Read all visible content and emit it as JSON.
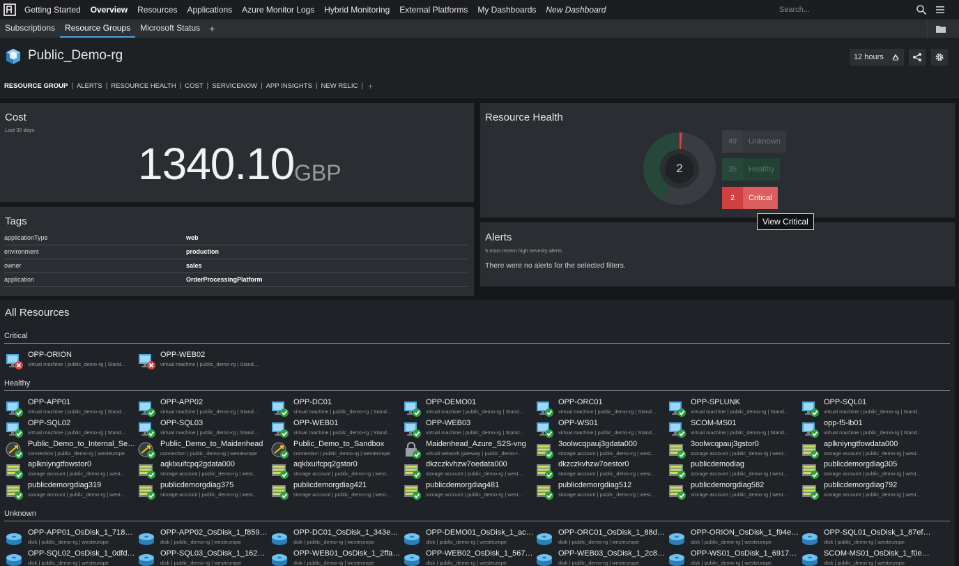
{
  "topnav": {
    "items": [
      {
        "label": "Getting Started"
      },
      {
        "label": "Overview"
      },
      {
        "label": "Resources"
      },
      {
        "label": "Applications"
      },
      {
        "label": "Azure Monitor Logs"
      },
      {
        "label": "Hybrid Monitoring"
      },
      {
        "label": "External Platforms"
      },
      {
        "label": "My Dashboards"
      },
      {
        "label": "New Dashboard"
      }
    ],
    "search_placeholder": "Search..."
  },
  "subnav": {
    "items": [
      {
        "label": "Subscriptions"
      },
      {
        "label": "Resource Groups"
      },
      {
        "label": "Microsoft Status"
      }
    ],
    "add_label": "+"
  },
  "header": {
    "title": "Public_Demo-rg",
    "time_range": "12 hours"
  },
  "tabs": {
    "items": [
      "RESOURCE GROUP",
      "ALERTS",
      "RESOURCE HEALTH",
      "COST",
      "SERVICENOW",
      "APP INSIGHTS",
      "NEW RELIC"
    ],
    "add_label": "+"
  },
  "cost": {
    "title": "Cost",
    "subtitle": "Last 30 days",
    "value": "1340.10",
    "unit": "GBP"
  },
  "tags": {
    "title": "Tags",
    "rows": [
      {
        "key": "applicationType",
        "value": "web"
      },
      {
        "key": "environment",
        "value": "production"
      },
      {
        "key": "owner",
        "value": "sales"
      },
      {
        "key": "application",
        "value": "OrderProcessingPlatform"
      }
    ]
  },
  "health": {
    "title": "Resource Health",
    "center_value": "2",
    "unknown_count": "49",
    "unknown_label": "Unknown",
    "healthy_count": "35",
    "healthy_label": "Healthy",
    "critical_count": "2",
    "critical_label": "Critical",
    "tooltip": "View Critical",
    "colors": {
      "unknown": "#393c40",
      "healthy": "#26473a",
      "critical": "#d64545"
    }
  },
  "alerts": {
    "title": "Alerts",
    "subtitle": "5 most recent high severity alerts",
    "message": "There were no alerts for the selected filters."
  },
  "all_resources": {
    "title": "All Resources",
    "sections": [
      {
        "label": "Critical",
        "items": [
          {
            "name": "OPP-ORION",
            "sub": "virtual machine | public_demo-rg | Stand...",
            "icon": "vm-critical-icon"
          },
          {
            "name": "OPP-WEB02",
            "sub": "virtual machine | public_demo-rg | Stand...",
            "icon": "vm-critical-icon"
          }
        ]
      },
      {
        "label": "Healthy",
        "items": [
          {
            "name": "OPP-APP01",
            "sub": "virtual machine | public_demo-rg | Stand...",
            "icon": "vm-healthy-icon"
          },
          {
            "name": "OPP-APP02",
            "sub": "virtual machine | public_demo-rg | Stand...",
            "icon": "vm-healthy-icon"
          },
          {
            "name": "OPP-DC01",
            "sub": "virtual machine | public_demo-rg | Stand...",
            "icon": "vm-healthy-icon"
          },
          {
            "name": "OPP-DEMO01",
            "sub": "virtual machine | public_demo-rg | Stand...",
            "icon": "vm-healthy-icon"
          },
          {
            "name": "OPP-ORC01",
            "sub": "virtual machine | public_demo-rg | Stand...",
            "icon": "vm-healthy-icon"
          },
          {
            "name": "OPP-SPLUNK",
            "sub": "virtual machine | public_demo-rg | Stand...",
            "icon": "vm-healthy-icon"
          },
          {
            "name": "OPP-SQL01",
            "sub": "virtual machine | public_demo-rg | Stand...",
            "icon": "vm-healthy-icon"
          },
          {
            "name": "OPP-SQL02",
            "sub": "virtual machine | public_demo-rg | Stand...",
            "icon": "vm-healthy-icon"
          },
          {
            "name": "OPP-SQL03",
            "sub": "virtual machine | public_demo-rg | Stand...",
            "icon": "vm-healthy-icon"
          },
          {
            "name": "OPP-WEB01",
            "sub": "virtual machine | public_demo-rg | Stand...",
            "icon": "vm-healthy-icon"
          },
          {
            "name": "OPP-WEB03",
            "sub": "virtual machine | public_demo-rg | Stand...",
            "icon": "vm-healthy-icon"
          },
          {
            "name": "OPP-WS01",
            "sub": "virtual machine | public_demo-rg | Stand...",
            "icon": "vm-healthy-icon"
          },
          {
            "name": "SCOM-MS01",
            "sub": "virtual machine | public_demo-rg | Stand...",
            "icon": "vm-healthy-icon"
          },
          {
            "name": "opp-f5-lb01",
            "sub": "virtual machine | public_demo-rg | Stand...",
            "icon": "vm-healthy-icon"
          },
          {
            "name": "Public_Demo_to_Internal_Servi...",
            "sub": "connection | public_demo-rg | westeurope",
            "icon": "connection-icon"
          },
          {
            "name": "Public_Demo_to_Maidenhead",
            "sub": "connection | public_demo-rg | westeurope",
            "icon": "connection-icon"
          },
          {
            "name": "Public_Demo_to_Sandbox",
            "sub": "connection | public_demo-rg | westeurope",
            "icon": "connection-icon"
          },
          {
            "name": "Maidenhead_Azure_S2S-vng",
            "sub": "virtual network gateway | public_demo-r...",
            "icon": "gateway-icon"
          },
          {
            "name": "3oolwcqpauj3gdata000",
            "sub": "storage account | public_demo-rg | west...",
            "icon": "storage-icon"
          },
          {
            "name": "3oolwcqpauj3gstor0",
            "sub": "storage account | public_demo-rg | west...",
            "icon": "storage-icon"
          },
          {
            "name": "aplkniyngtfowdata000",
            "sub": "storage account | public_demo-rg | west...",
            "icon": "storage-icon"
          },
          {
            "name": "aplkniyngtfowstor0",
            "sub": "storage account | public_demo-rg | west...",
            "icon": "storage-icon"
          },
          {
            "name": "aqklxuifcpq2gdata000",
            "sub": "storage account | public_demo-rg | west...",
            "icon": "storage-icon"
          },
          {
            "name": "aqklxuifcpq2gstor0",
            "sub": "storage account | public_demo-rg | west...",
            "icon": "storage-icon"
          },
          {
            "name": "dkzczkvhzw7oedata000",
            "sub": "storage account | public_demo-rg | west...",
            "icon": "storage-icon"
          },
          {
            "name": "dkzczkvhzw7oestor0",
            "sub": "storage account | public_demo-rg | west...",
            "icon": "storage-icon"
          },
          {
            "name": "publicdemodiag",
            "sub": "storage account | public_demo-rg | west...",
            "icon": "storage-icon"
          },
          {
            "name": "publicdemorgdiag305",
            "sub": "storage account | public_demo-rg | west...",
            "icon": "storage-icon"
          },
          {
            "name": "publicdemorgdiag319",
            "sub": "storage account | public_demo-rg | west...",
            "icon": "storage-icon"
          },
          {
            "name": "publicdemorgdiag375",
            "sub": "storage account | public_demo-rg | west...",
            "icon": "storage-icon"
          },
          {
            "name": "publicdemorgdiag421",
            "sub": "storage account | public_demo-rg | west...",
            "icon": "storage-icon"
          },
          {
            "name": "publicdemorgdiag481",
            "sub": "storage account | public_demo-rg | west...",
            "icon": "storage-icon"
          },
          {
            "name": "publicdemorgdiag512",
            "sub": "storage account | public_demo-rg | west...",
            "icon": "storage-icon"
          },
          {
            "name": "publicdemorgdiag582",
            "sub": "storage account | public_demo-rg | west...",
            "icon": "storage-icon"
          },
          {
            "name": "publicdemorgdiag792",
            "sub": "storage account | public_demo-rg | west...",
            "icon": "storage-icon"
          }
        ]
      },
      {
        "label": "Unknown",
        "items": [
          {
            "name": "OPP-APP01_OsDisk_1_718acb...",
            "sub": "disk | public_demo-rg | westeurope",
            "icon": "disk-icon"
          },
          {
            "name": "OPP-APP02_OsDisk_1_f85919...",
            "sub": "disk | public_demo-rg | westeurope",
            "icon": "disk-icon"
          },
          {
            "name": "OPP-DC01_OsDisk_1_343e7ab...",
            "sub": "disk | public_demo-rg | westeurope",
            "icon": "disk-icon"
          },
          {
            "name": "OPP-DEMO01_OsDisk_1_aca2...",
            "sub": "disk | public_demo-rg | westeurope",
            "icon": "disk-icon"
          },
          {
            "name": "OPP-ORC01_OsDisk_1_88d69f...",
            "sub": "disk | public_demo-rg | westeurope",
            "icon": "disk-icon"
          },
          {
            "name": "OPP-ORION_OsDisk_1_f94e7a...",
            "sub": "disk | public_demo-rg | westeurope",
            "icon": "disk-icon"
          },
          {
            "name": "OPP-SQL01_OsDisk_1_87efeb...",
            "sub": "disk | public_demo-rg | westeurope",
            "icon": "disk-icon"
          },
          {
            "name": "OPP-SQL02_OsDisk_1_0dfdd8...",
            "sub": "disk | public_demo-rg | westeurope",
            "icon": "disk-icon"
          },
          {
            "name": "OPP-SQL03_OsDisk_1_162dd9...",
            "sub": "disk | public_demo-rg | westeurope",
            "icon": "disk-icon"
          },
          {
            "name": "OPP-WEB01_OsDisk_1_2ffa39...",
            "sub": "disk | public_demo-rg | westeurope",
            "icon": "disk-icon"
          },
          {
            "name": "OPP-WEB02_OsDisk_1_567fc4...",
            "sub": "disk | public_demo-rg | westeurope",
            "icon": "disk-icon"
          },
          {
            "name": "OPP-WEB03_OsDisk_1_2c8c79...",
            "sub": "disk | public_demo-rg | westeurope",
            "icon": "disk-icon"
          },
          {
            "name": "OPP-WS01_OsDisk_1_691712e...",
            "sub": "disk | public_demo-rg | westeurope",
            "icon": "disk-icon"
          },
          {
            "name": "SCOM-MS01_OsDisk_1_f0e08...",
            "sub": "disk | public_demo-rg | westeurope",
            "icon": "disk-icon"
          }
        ]
      }
    ]
  }
}
